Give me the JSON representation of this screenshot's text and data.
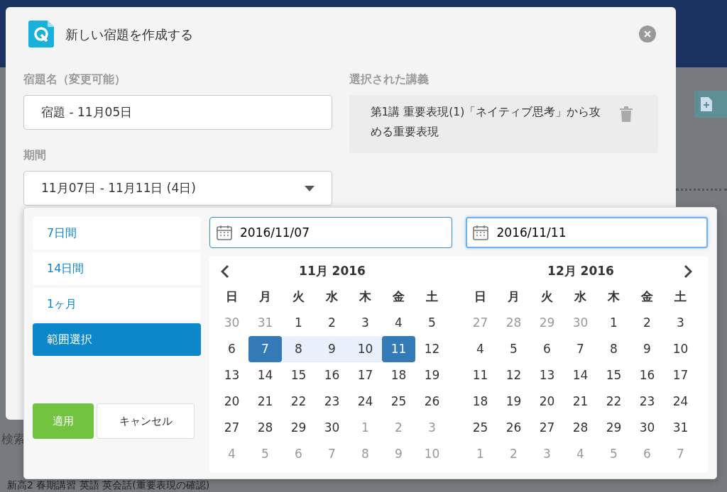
{
  "background": {
    "search_label": "検索",
    "row_text": "新高2 春期講習 英語 英会話(重要表現の確認)"
  },
  "dialog": {
    "title": "新しい宿題を作成する",
    "name_field": {
      "label": "宿題名（変更可能）",
      "value": "宿題 - 11月05日"
    },
    "period_field": {
      "label": "期間",
      "value": "11月07日 - 11月11日 (4日)"
    },
    "lecture": {
      "label": "選択された講義",
      "text": "第1講 重要表現(1)「ネイティブ思考」から攻める重要表現"
    }
  },
  "picker": {
    "ranges": [
      {
        "label": "7日間",
        "selected": false
      },
      {
        "label": "14日間",
        "selected": false
      },
      {
        "label": "1ヶ月",
        "selected": false
      },
      {
        "label": "範囲選択",
        "selected": true
      }
    ],
    "apply_button": "適用",
    "cancel_button": "キャンセル",
    "start_input": {
      "value": "2016/11/07",
      "focused": false
    },
    "end_input": {
      "value": "2016/11/11",
      "focused": true
    },
    "calendars": [
      {
        "title": "11月 2016",
        "has_prev": true,
        "has_next": false,
        "weekdays": [
          "日",
          "月",
          "火",
          "水",
          "木",
          "金",
          "土"
        ],
        "weeks": [
          [
            {
              "label": "30",
              "muted": true,
              "selected": false,
              "in_range": false
            },
            {
              "label": "31",
              "muted": true,
              "selected": false,
              "in_range": false
            },
            {
              "label": "1",
              "muted": false,
              "selected": false,
              "in_range": false
            },
            {
              "label": "2",
              "muted": false,
              "selected": false,
              "in_range": false
            },
            {
              "label": "3",
              "muted": false,
              "selected": false,
              "in_range": false
            },
            {
              "label": "4",
              "muted": false,
              "selected": false,
              "in_range": false
            },
            {
              "label": "5",
              "muted": false,
              "selected": false,
              "in_range": false
            }
          ],
          [
            {
              "label": "6",
              "muted": false,
              "selected": false,
              "in_range": false
            },
            {
              "label": "7",
              "muted": false,
              "selected": true,
              "in_range": false
            },
            {
              "label": "8",
              "muted": false,
              "selected": false,
              "in_range": true
            },
            {
              "label": "9",
              "muted": false,
              "selected": false,
              "in_range": true
            },
            {
              "label": "10",
              "muted": false,
              "selected": false,
              "in_range": true
            },
            {
              "label": "11",
              "muted": false,
              "selected": true,
              "in_range": false
            },
            {
              "label": "12",
              "muted": false,
              "selected": false,
              "in_range": false
            }
          ],
          [
            {
              "label": "13",
              "muted": false,
              "selected": false,
              "in_range": false
            },
            {
              "label": "14",
              "muted": false,
              "selected": false,
              "in_range": false
            },
            {
              "label": "15",
              "muted": false,
              "selected": false,
              "in_range": false
            },
            {
              "label": "16",
              "muted": false,
              "selected": false,
              "in_range": false
            },
            {
              "label": "17",
              "muted": false,
              "selected": false,
              "in_range": false
            },
            {
              "label": "18",
              "muted": false,
              "selected": false,
              "in_range": false
            },
            {
              "label": "19",
              "muted": false,
              "selected": false,
              "in_range": false
            }
          ],
          [
            {
              "label": "20",
              "muted": false,
              "selected": false,
              "in_range": false
            },
            {
              "label": "21",
              "muted": false,
              "selected": false,
              "in_range": false
            },
            {
              "label": "22",
              "muted": false,
              "selected": false,
              "in_range": false
            },
            {
              "label": "23",
              "muted": false,
              "selected": false,
              "in_range": false
            },
            {
              "label": "24",
              "muted": false,
              "selected": false,
              "in_range": false
            },
            {
              "label": "25",
              "muted": false,
              "selected": false,
              "in_range": false
            },
            {
              "label": "26",
              "muted": false,
              "selected": false,
              "in_range": false
            }
          ],
          [
            {
              "label": "27",
              "muted": false,
              "selected": false,
              "in_range": false
            },
            {
              "label": "28",
              "muted": false,
              "selected": false,
              "in_range": false
            },
            {
              "label": "29",
              "muted": false,
              "selected": false,
              "in_range": false
            },
            {
              "label": "30",
              "muted": false,
              "selected": false,
              "in_range": false
            },
            {
              "label": "1",
              "muted": true,
              "selected": false,
              "in_range": false
            },
            {
              "label": "2",
              "muted": true,
              "selected": false,
              "in_range": false
            },
            {
              "label": "3",
              "muted": true,
              "selected": false,
              "in_range": false
            }
          ],
          [
            {
              "label": "4",
              "muted": true,
              "selected": false,
              "in_range": false
            },
            {
              "label": "5",
              "muted": true,
              "selected": false,
              "in_range": false
            },
            {
              "label": "6",
              "muted": true,
              "selected": false,
              "in_range": false
            },
            {
              "label": "7",
              "muted": true,
              "selected": false,
              "in_range": false
            },
            {
              "label": "8",
              "muted": true,
              "selected": false,
              "in_range": false
            },
            {
              "label": "9",
              "muted": true,
              "selected": false,
              "in_range": false
            },
            {
              "label": "10",
              "muted": true,
              "selected": false,
              "in_range": false
            }
          ]
        ]
      },
      {
        "title": "12月 2016",
        "has_prev": false,
        "has_next": true,
        "weekdays": [
          "日",
          "月",
          "火",
          "水",
          "木",
          "金",
          "土"
        ],
        "weeks": [
          [
            {
              "label": "27",
              "muted": true,
              "selected": false,
              "in_range": false
            },
            {
              "label": "28",
              "muted": true,
              "selected": false,
              "in_range": false
            },
            {
              "label": "29",
              "muted": true,
              "selected": false,
              "in_range": false
            },
            {
              "label": "30",
              "muted": true,
              "selected": false,
              "in_range": false
            },
            {
              "label": "1",
              "muted": false,
              "selected": false,
              "in_range": false
            },
            {
              "label": "2",
              "muted": false,
              "selected": false,
              "in_range": false
            },
            {
              "label": "3",
              "muted": false,
              "selected": false,
              "in_range": false
            }
          ],
          [
            {
              "label": "4",
              "muted": false,
              "selected": false,
              "in_range": false
            },
            {
              "label": "5",
              "muted": false,
              "selected": false,
              "in_range": false
            },
            {
              "label": "6",
              "muted": false,
              "selected": false,
              "in_range": false
            },
            {
              "label": "7",
              "muted": false,
              "selected": false,
              "in_range": false
            },
            {
              "label": "8",
              "muted": false,
              "selected": false,
              "in_range": false
            },
            {
              "label": "9",
              "muted": false,
              "selected": false,
              "in_range": false
            },
            {
              "label": "10",
              "muted": false,
              "selected": false,
              "in_range": false
            }
          ],
          [
            {
              "label": "11",
              "muted": false,
              "selected": false,
              "in_range": false
            },
            {
              "label": "12",
              "muted": false,
              "selected": false,
              "in_range": false
            },
            {
              "label": "13",
              "muted": false,
              "selected": false,
              "in_range": false
            },
            {
              "label": "14",
              "muted": false,
              "selected": false,
              "in_range": false
            },
            {
              "label": "15",
              "muted": false,
              "selected": false,
              "in_range": false
            },
            {
              "label": "16",
              "muted": false,
              "selected": false,
              "in_range": false
            },
            {
              "label": "17",
              "muted": false,
              "selected": false,
              "in_range": false
            }
          ],
          [
            {
              "label": "18",
              "muted": false,
              "selected": false,
              "in_range": false
            },
            {
              "label": "19",
              "muted": false,
              "selected": false,
              "in_range": false
            },
            {
              "label": "20",
              "muted": false,
              "selected": false,
              "in_range": false
            },
            {
              "label": "21",
              "muted": false,
              "selected": false,
              "in_range": false
            },
            {
              "label": "22",
              "muted": false,
              "selected": false,
              "in_range": false
            },
            {
              "label": "23",
              "muted": false,
              "selected": false,
              "in_range": false
            },
            {
              "label": "24",
              "muted": false,
              "selected": false,
              "in_range": false
            }
          ],
          [
            {
              "label": "25",
              "muted": false,
              "selected": false,
              "in_range": false
            },
            {
              "label": "26",
              "muted": false,
              "selected": false,
              "in_range": false
            },
            {
              "label": "27",
              "muted": false,
              "selected": false,
              "in_range": false
            },
            {
              "label": "28",
              "muted": false,
              "selected": false,
              "in_range": false
            },
            {
              "label": "29",
              "muted": false,
              "selected": false,
              "in_range": false
            },
            {
              "label": "30",
              "muted": false,
              "selected": false,
              "in_range": false
            },
            {
              "label": "31",
              "muted": false,
              "selected": false,
              "in_range": false
            }
          ],
          [
            {
              "label": "1",
              "muted": true,
              "selected": false,
              "in_range": false
            },
            {
              "label": "2",
              "muted": true,
              "selected": false,
              "in_range": false
            },
            {
              "label": "3",
              "muted": true,
              "selected": false,
              "in_range": false
            },
            {
              "label": "4",
              "muted": true,
              "selected": false,
              "in_range": false
            },
            {
              "label": "5",
              "muted": true,
              "selected": false,
              "in_range": false
            },
            {
              "label": "6",
              "muted": true,
              "selected": false,
              "in_range": false
            },
            {
              "label": "7",
              "muted": true,
              "selected": false,
              "in_range": false
            }
          ]
        ]
      }
    ]
  }
}
